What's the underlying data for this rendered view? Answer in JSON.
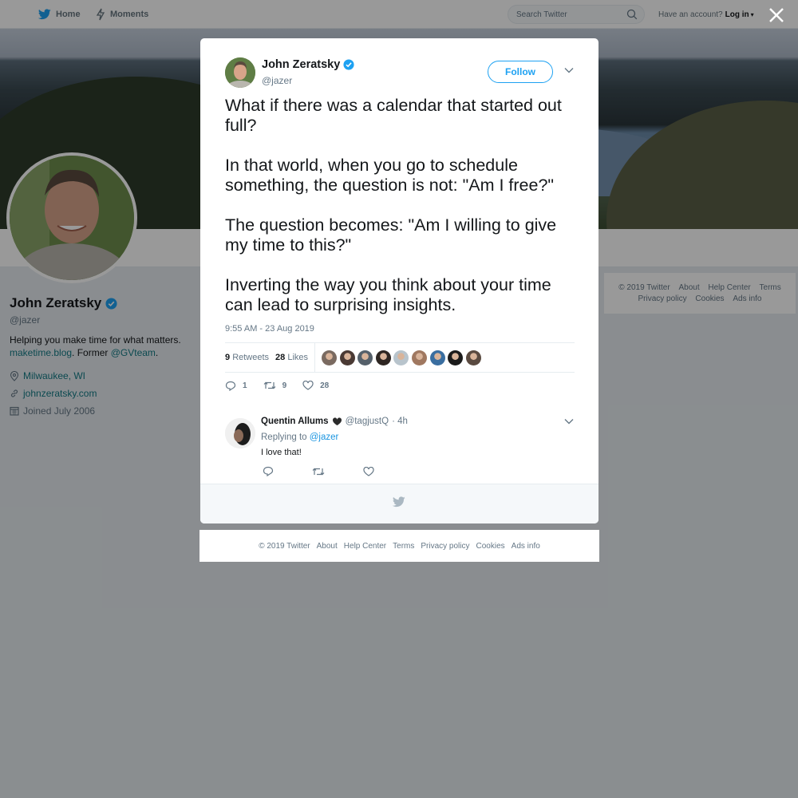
{
  "topbar": {
    "home_label": "Home",
    "moments_label": "Moments",
    "search_placeholder": "Search Twitter",
    "account_prompt": "Have an account?",
    "login_label": "Log in"
  },
  "profile": {
    "name": "John Zeratsky",
    "handle": "@jazer",
    "bio_line1": "Helping you make time for what matters.",
    "bio_link1": "maketime.blog",
    "bio_mid": ". Former ",
    "bio_link2": "@GVteam",
    "bio_end": ".",
    "location": "Milwaukee, WI",
    "website": "johnzeratsky.com",
    "joined": "Joined July 2006"
  },
  "side_footer": {
    "items_row1": [
      "© 2019 Twitter",
      "About",
      "Help Center",
      "Terms"
    ],
    "items_row2": [
      "Privacy policy",
      "Cookies",
      "Ads info"
    ]
  },
  "tweet": {
    "author_name": "John Zeratsky",
    "author_handle": "@jazer",
    "follow_label": "Follow",
    "paragraphs": [
      "What if there was a calendar that started out full?",
      "In that world, when you go to schedule something, the question is not: \"Am I free?\"",
      "The question becomes: \"Am I willing to give my time to this?\"",
      "Inverting the way you think about your time can lead to surprising insights."
    ],
    "timestamp": "9:55 AM - 23 Aug 2019",
    "retweets_count": "9",
    "retweets_label": "Retweets",
    "likes_count": "28",
    "likes_label": "Likes",
    "liker_colors": [
      "#7a6a60",
      "#4a3a34",
      "#55606a",
      "#2e2622",
      "#b8c4cc",
      "#a07860",
      "#3a6ea0",
      "#1b1b1b",
      "#5a4a40"
    ],
    "reply_count": "1",
    "retweet_count": "9",
    "like_count": "28"
  },
  "reply": {
    "name": "Quentin Allums",
    "handle": "@tagjustQ",
    "time": "· 4h",
    "replying_prefix": "Replying to",
    "replying_to": "@jazer",
    "text": "I love that!"
  },
  "modal_footer": {
    "items": [
      "© 2019 Twitter",
      "About",
      "Help Center",
      "Terms",
      "Privacy policy",
      "Cookies",
      "Ads info"
    ]
  },
  "colors": {
    "accent": "#1da1f2",
    "link": "#137a85",
    "muted": "#657786"
  }
}
